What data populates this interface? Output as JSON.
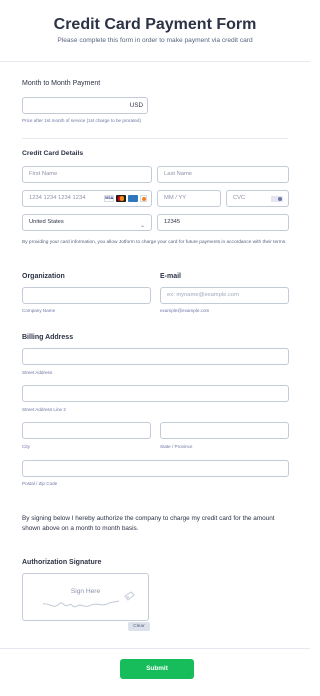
{
  "header": {
    "title": "Credit Card Payment Form",
    "subtitle": "Please complete this form in order to make payment via credit card"
  },
  "payment": {
    "label": "Month to Month Payment",
    "currency": "USD",
    "note": "Price after 1st month of service (1st charge to be prorated)"
  },
  "card": {
    "label": "Credit Card Details",
    "first_name_placeholder": "First Name",
    "last_name_placeholder": "Last Name",
    "card_number_placeholder": "1234 1234 1234 1234",
    "card_brands": [
      "VISA",
      "mastercard",
      "AMEX",
      "discover"
    ],
    "expiry_placeholder": "MM / YY",
    "cvc_placeholder": "CVC",
    "country_value": "United States",
    "zip_value": "12345",
    "consent": "By providing your card information, you allow Jotform to charge your card for future payments in accordance with their terms."
  },
  "organization": {
    "label": "Organization",
    "sublabel": "Company Name"
  },
  "email": {
    "label": "E-mail",
    "placeholder": "ex: myname@example.com",
    "sublabel": "example@example.com"
  },
  "billing": {
    "label": "Billing Address",
    "street_sublabel": "Street Address",
    "street2_sublabel": "Street Address Line 2",
    "city_sublabel": "City",
    "state_sublabel": "State / Province",
    "postal_sublabel": "Postal / Zip Code"
  },
  "authorization": {
    "text": "By signing below I hereby authorize the company to charge my credit card for the amount shown above on a month to month basis.",
    "signature_label": "Authorization Signature",
    "signature_placeholder": "Sign Here",
    "clear_label": "Clear"
  },
  "submit_label": "Submit",
  "colors": {
    "submit": "#18bd5b",
    "border": "#c3cad8",
    "text": "#2c3345",
    "sublabel": "#6f76a7"
  }
}
